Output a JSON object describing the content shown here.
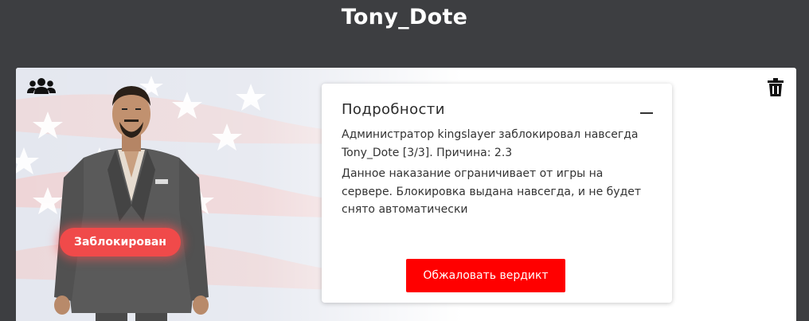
{
  "player": {
    "name": "Tony_Dote"
  },
  "status": {
    "label": "Заблокирован",
    "color": "#f04a4a"
  },
  "icons": {
    "group": "group-icon",
    "delete": "trash-icon",
    "collapse": "minus-icon"
  },
  "details": {
    "title": "Подробности",
    "message": "Администратор kingslayer заблокировал навсегда Tony_Dote [3/3]. Причина: 2.3",
    "description": "Данное наказание ограничивает от игры на сервере. Блокировка выдана навсегда, и не будет снято автоматически",
    "appeal_button": "Обжаловать вердикт"
  },
  "colors": {
    "background": "#3d3e41",
    "accent": "#ff0000",
    "card": "#ffffff"
  }
}
